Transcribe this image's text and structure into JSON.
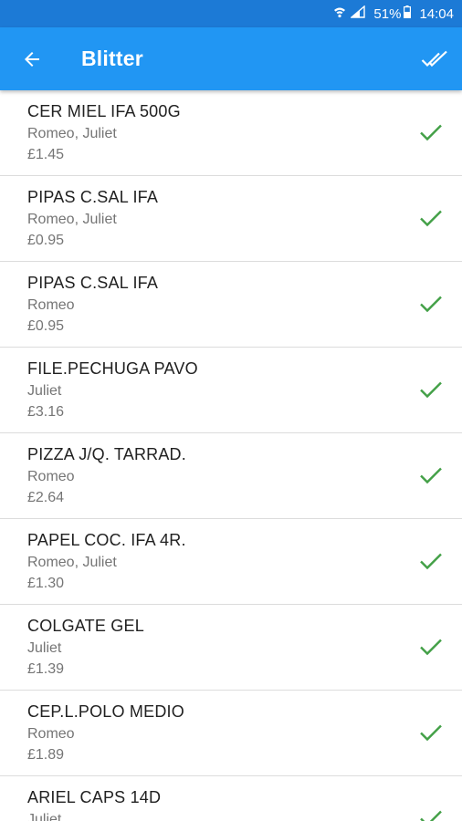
{
  "status_bar": {
    "battery": "51%",
    "time": "14:04"
  },
  "app_bar": {
    "title": "Blitter",
    "back_icon": "arrow-back-icon",
    "action_icon": "done-all-icon"
  },
  "colors": {
    "status_bar": "#1c7ad6",
    "app_bar": "#2196f3",
    "check": "#43a047",
    "divider": "#dcdcdc"
  },
  "items": [
    {
      "name": "CER MIEL IFA 500G",
      "people": "Romeo, Juliet",
      "price": "£1.45"
    },
    {
      "name": "PIPAS C.SAL IFA",
      "people": "Romeo, Juliet",
      "price": "£0.95"
    },
    {
      "name": "PIPAS C.SAL IFA",
      "people": "Romeo",
      "price": "£0.95"
    },
    {
      "name": "FILE.PECHUGA PAVO",
      "people": "Juliet",
      "price": "£3.16"
    },
    {
      "name": "PIZZA J/Q. TARRAD.",
      "people": "Romeo",
      "price": "£2.64"
    },
    {
      "name": "PAPEL COC. IFA 4R.",
      "people": "Romeo, Juliet",
      "price": "£1.30"
    },
    {
      "name": "COLGATE GEL",
      "people": "Juliet",
      "price": "£1.39"
    },
    {
      "name": "CEP.L.POLO MEDIO",
      "people": "Romeo",
      "price": "£1.89"
    },
    {
      "name": "ARIEL CAPS 14D",
      "people": "Juliet",
      "price": ""
    }
  ]
}
